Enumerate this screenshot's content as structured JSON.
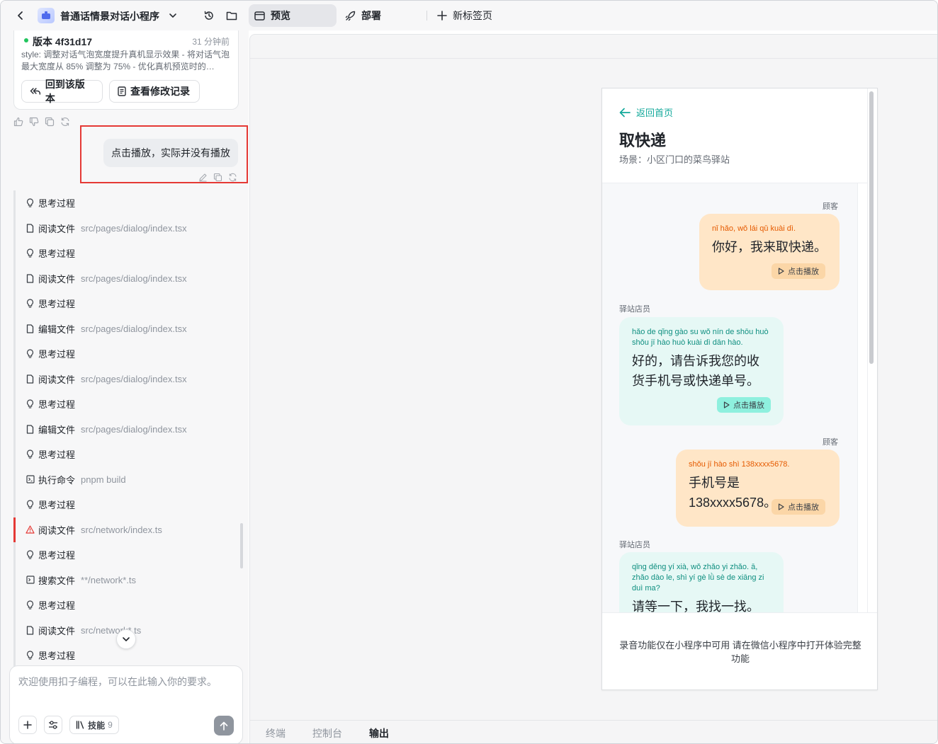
{
  "topbar": {
    "app_title": "普通话情景对话小程序",
    "tabs": [
      {
        "label": "预览",
        "icon": "preview-icon"
      },
      {
        "label": "部署",
        "icon": "rocket-icon"
      },
      {
        "label": "新标签页",
        "icon": "plus-icon"
      }
    ]
  },
  "version": {
    "name": "版本 4f31d17",
    "time": "31 分钟前",
    "description": "style: 调整对话气泡宽度提升真机显示效果 - 将对话气泡最大宽度从 85% 调整为 75% - 优化真机预览时的…",
    "restore_label": "回到该版本",
    "changelog_label": "查看修改记录",
    "status_color": "#22c55e"
  },
  "user_message": "点击播放，实际并没有播放",
  "steps": [
    {
      "icon": "bulb-icon",
      "label": "思考过程",
      "path": ""
    },
    {
      "icon": "file-icon",
      "label": "阅读文件",
      "path": "src/pages/dialog/index.tsx"
    },
    {
      "icon": "bulb-icon",
      "label": "思考过程",
      "path": ""
    },
    {
      "icon": "file-icon",
      "label": "阅读文件",
      "path": "src/pages/dialog/index.tsx"
    },
    {
      "icon": "bulb-icon",
      "label": "思考过程",
      "path": ""
    },
    {
      "icon": "file-icon",
      "label": "编辑文件",
      "path": "src/pages/dialog/index.tsx"
    },
    {
      "icon": "bulb-icon",
      "label": "思考过程",
      "path": ""
    },
    {
      "icon": "file-icon",
      "label": "阅读文件",
      "path": "src/pages/dialog/index.tsx"
    },
    {
      "icon": "bulb-icon",
      "label": "思考过程",
      "path": ""
    },
    {
      "icon": "file-icon",
      "label": "编辑文件",
      "path": "src/pages/dialog/index.tsx"
    },
    {
      "icon": "bulb-icon",
      "label": "思考过程",
      "path": ""
    },
    {
      "icon": "terminal-icon",
      "label": "执行命令",
      "path": "pnpm build"
    },
    {
      "icon": "bulb-icon",
      "label": "思考过程",
      "path": ""
    },
    {
      "icon": "warning-icon",
      "label": "阅读文件",
      "path": "src/network/index.ts",
      "warn": true
    },
    {
      "icon": "bulb-icon",
      "label": "思考过程",
      "path": ""
    },
    {
      "icon": "search-file-icon",
      "label": "搜索文件",
      "path": "**/network*.ts"
    },
    {
      "icon": "bulb-icon",
      "label": "思考过程",
      "path": ""
    },
    {
      "icon": "file-icon",
      "label": "阅读文件",
      "path": "src/network*.ts"
    },
    {
      "icon": "bulb-icon",
      "label": "思考过程",
      "path": ""
    }
  ],
  "composer": {
    "placeholder": "欢迎使用扣子编程，可以在此输入你的要求。",
    "skills_label": "技能",
    "skills_count": "9"
  },
  "bottom_tabs": [
    "终端",
    "控制台",
    "输出"
  ],
  "phone": {
    "back_label": "返回首页",
    "title": "取快递",
    "scene": "场景：小区门口的菜鸟驿站",
    "accent": "#13a99b",
    "messages": [
      {
        "role": "顾客",
        "pinyin": "nǐ hǎo, wǒ lái qǔ kuài dì.",
        "text": "你好，我来取快递。",
        "play": "点击播放"
      },
      {
        "role": "驿站店员",
        "pinyin": "hǎo de qǐng gào su wǒ nín de shōu huò shǒu jī hào huò kuài dì dān hào.",
        "text": "好的，请告诉我您的收货手机号或快递单号。",
        "play": "点击播放"
      },
      {
        "role": "顾客",
        "pinyin": "shǒu jī hào shì 138xxxx5678.",
        "text": "手机号是138xxxx5678。",
        "play": "点击播放"
      },
      {
        "role": "驿站店员",
        "pinyin": "qǐng děng yí xià, wǒ zhǎo yi zhǎo. ā, zhǎo dào le, shì yí gè lǜ sè de xiāng zi duì ma?",
        "text": "请等一下，我找一找。",
        "play": ""
      }
    ],
    "footer": "录音功能仅在小程序中可用 请在微信小程序中打开体验完整功能"
  }
}
